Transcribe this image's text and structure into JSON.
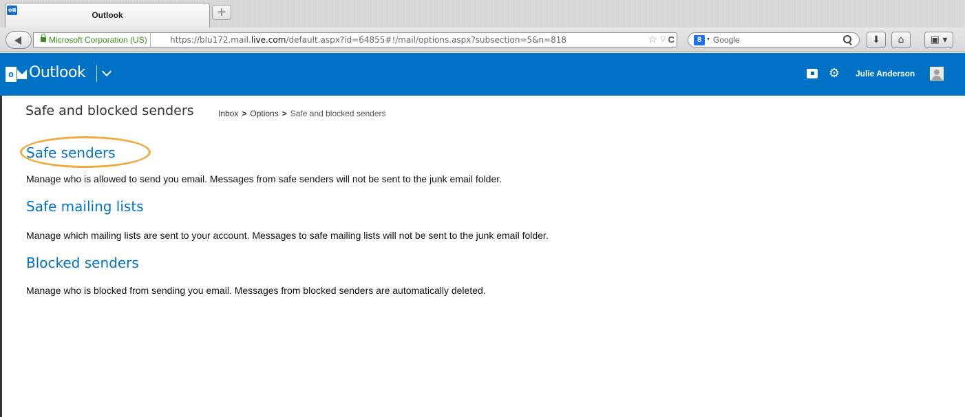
{
  "browser": {
    "tab": {
      "title": "Outlook",
      "favicon_label": "o"
    },
    "new_tab_label": "+",
    "identity": "Microsoft Corporation (US)",
    "url_prefix": "https://blu172.mail.",
    "url_domain": "live.com",
    "url_suffix": "/default.aspx?id=64855#!/mail/options.aspx?subsection=5&n=818",
    "search_engine": "Google",
    "icons": {
      "back": "back-arrow-icon",
      "lock": "lock-icon",
      "star": "star-icon",
      "dropdown": "dropdown-icon",
      "reload": "reload-icon",
      "search": "search-icon",
      "download": "download-icon",
      "home": "home-icon",
      "bookmarks": "bookmarks-icon"
    },
    "glyphs": {
      "star": "☆",
      "dropdown": "▽",
      "reload": "C",
      "caret": "▾",
      "download": "⬇",
      "home": "⌂",
      "bookmarks": "▣ ▾",
      "google": "8"
    }
  },
  "app": {
    "name": "Outlook",
    "logo_letter": "o",
    "user_name": "Julie Anderson",
    "gear_glyph": "⚙",
    "brand_color": "#0072c6"
  },
  "page": {
    "title": "Safe and blocked senders",
    "breadcrumb": {
      "items": [
        "Inbox",
        "Options"
      ],
      "separator": ">",
      "current": "Safe and blocked senders"
    },
    "sections": [
      {
        "title": "Safe senders",
        "description": "Manage who is allowed to send you email. Messages from safe senders will not be sent to the junk email folder."
      },
      {
        "title": "Safe mailing lists",
        "description": "Manage which mailing lists are sent to your account. Messages to safe mailing lists will not be sent to the junk email folder."
      },
      {
        "title": "Blocked senders",
        "description": "Manage who is blocked from sending you email. Messages from blocked senders are automatically deleted."
      }
    ],
    "highlight_color": "#f1a93b"
  }
}
